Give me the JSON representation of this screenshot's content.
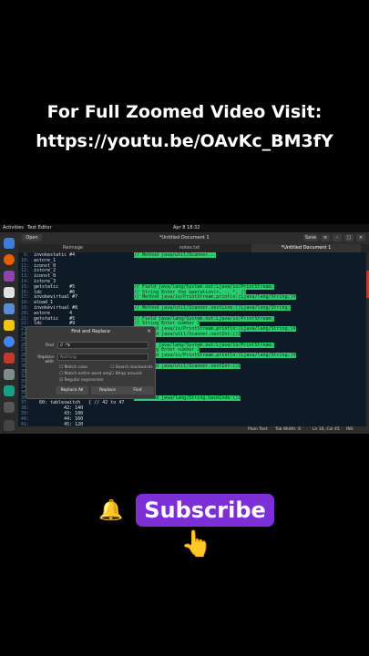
{
  "promo": {
    "line1": "For Full Zoomed Video Visit:",
    "line2": "https://youtu.be/OAvKc_BM3fY"
  },
  "topbar": {
    "activities": "Activities",
    "app": "Text Editor",
    "clock": "Apr 8  18:32"
  },
  "headerbar": {
    "open_label": "Open",
    "title": "*Untitled Document 1",
    "save_label": "Save"
  },
  "tabs": [
    {
      "label": "Reimage"
    },
    {
      "label": "notes.txt"
    },
    {
      "label": "*Untitled Document 1"
    }
  ],
  "editor": {
    "lines": [
      {
        "num": "9:",
        "code": "invokestatic #4",
        "comment": "// Method java/util/Scanner..."
      },
      {
        "num": "10:",
        "code": "astore_1",
        "comment": ""
      },
      {
        "num": "11:",
        "code": "iconst_0",
        "comment": ""
      },
      {
        "num": "12:",
        "code": "istore_2",
        "comment": ""
      },
      {
        "num": "13:",
        "code": "iconst_0",
        "comment": ""
      },
      {
        "num": "14:",
        "code": "istore_3",
        "comment": ""
      },
      {
        "num": "15:",
        "code": "getstatic    #5",
        "comment": "// Field java/lang/System.out:Ljava/io/PrintStream;"
      },
      {
        "num": "16:",
        "code": "ldc          #6",
        "comment": "// String Enter the operation(+, -, *, /)"
      },
      {
        "num": "17:",
        "code": "invokevirtual #7",
        "comment": "// Method java/io/PrintStream.println:(Ljava/lang/String;)V"
      },
      {
        "num": "18:",
        "code": "aload_1",
        "comment": ""
      },
      {
        "num": "19:",
        "code": "invokevirtual #8",
        "comment": "// Method java/util/Scanner.nextLine:()Ljava/lang/String;"
      },
      {
        "num": "20:",
        "code": "astore       4",
        "comment": ""
      },
      {
        "num": "21:",
        "code": "getstatic    #5",
        "comment": "// Field java/lang/System.out:Ljava/io/PrintStream;"
      },
      {
        "num": "22:",
        "code": "ldc          #9",
        "comment": "// String Enter number 1"
      },
      {
        "num": "23:",
        "code": "invokevirtual #7",
        "comment": "// Method java/io/PrintStream.println:(Ljava/lang/String;)V"
      },
      {
        "num": "24:",
        "code": "",
        "comment": "// Method java/util/Scanner.nextInt:()I"
      },
      {
        "num": "25:",
        "code": "",
        "comment": ""
      },
      {
        "num": "26:",
        "code": "",
        "comment": "// Field java/lang/System.out:Ljava/io/PrintStream;"
      },
      {
        "num": "27:",
        "code": "",
        "comment": "// String Enter number 2"
      },
      {
        "num": "28:",
        "code": "",
        "comment": "// Method java/io/PrintStream.println:(Ljava/lang/String;)V"
      },
      {
        "num": "29:",
        "code": "",
        "comment": ""
      },
      {
        "num": "30:",
        "code": "",
        "comment": "// Method java/util/Scanner.nextInt:()I"
      },
      {
        "num": "31:",
        "code": "",
        "comment": ""
      },
      {
        "num": "32:",
        "code": "",
        "comment": ""
      },
      {
        "num": "33:",
        "code": "",
        "comment": ""
      },
      {
        "num": "34:",
        "code": "",
        "comment": ""
      },
      {
        "num": "35:",
        "code": "",
        "comment": ""
      },
      {
        "num": "36:",
        "code": "",
        "comment": "// Method java/lang/String.hashCode:()I"
      },
      {
        "num": "37:",
        "code": "  60: tableswitch   { // 42 to 47",
        "comment": ""
      },
      {
        "num": "38:",
        "code": "           42: 140",
        "comment": ""
      },
      {
        "num": "39:",
        "code": "           43: 100",
        "comment": ""
      },
      {
        "num": "40:",
        "code": "           44: 160",
        "comment": ""
      },
      {
        "num": "41:",
        "code": "           45: 120",
        "comment": ""
      }
    ]
  },
  "dialog": {
    "title": "Find and Replace",
    "close": "×",
    "find_label": "Find",
    "find_value": "// .*$",
    "replace_label": "Replace with",
    "replace_placeholder": "Nothing",
    "match_case": "Match case",
    "search_backwards": "Search backwards",
    "match_entire_word": "Match entire word only",
    "wrap_around": "Wrap around",
    "regex": "Regular expression",
    "btn_replace_all": "Replace All",
    "btn_replace": "Replace",
    "btn_find": "Find"
  },
  "statusbar": {
    "lang": "Plain Text",
    "tab_width": "Tab Width: 8",
    "position": "Ln 16, Col 45",
    "mode": "INS"
  },
  "subscribe": {
    "label": "Subscribe",
    "bell_icon": "🔔",
    "hand_icon": "👆"
  },
  "colors": {
    "accent": "#7c2fd6",
    "highlight": "#2ecc71"
  }
}
